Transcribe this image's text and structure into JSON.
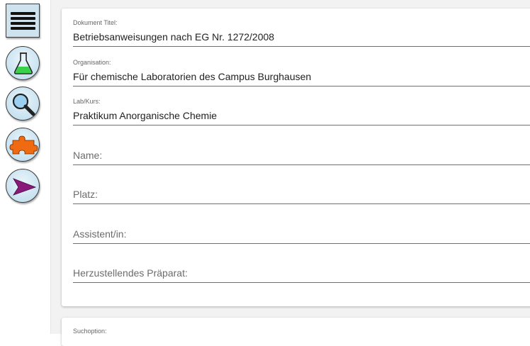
{
  "sidebar": {
    "menu_icon": "hamburger-menu-icon",
    "buttons": [
      {
        "name": "flask-icon",
        "color": "#39d14a"
      },
      {
        "name": "magnifier-icon",
        "color": "#2a8fd0"
      },
      {
        "name": "puzzle-icon",
        "color": "#f06a12"
      },
      {
        "name": "send-arrow-icon",
        "color": "#8a1a7a"
      }
    ]
  },
  "form": {
    "title_label": "Dokument Titel:",
    "title_value": "Betriebsanweisungen nach EG Nr. 1272/2008",
    "org_label": "Organisation:",
    "org_value": "Für chemische Laboratorien des Campus Burghausen",
    "lab_label": "Lab/Kurs:",
    "lab_value": "Praktikum Anorganische Chemie",
    "name_placeholder": "Name:",
    "place_placeholder": "Platz:",
    "assistant_placeholder": "Assistent/in:",
    "preparation_placeholder": "Herzustellendes Präparat:"
  },
  "search": {
    "label": "Suchoption:"
  }
}
